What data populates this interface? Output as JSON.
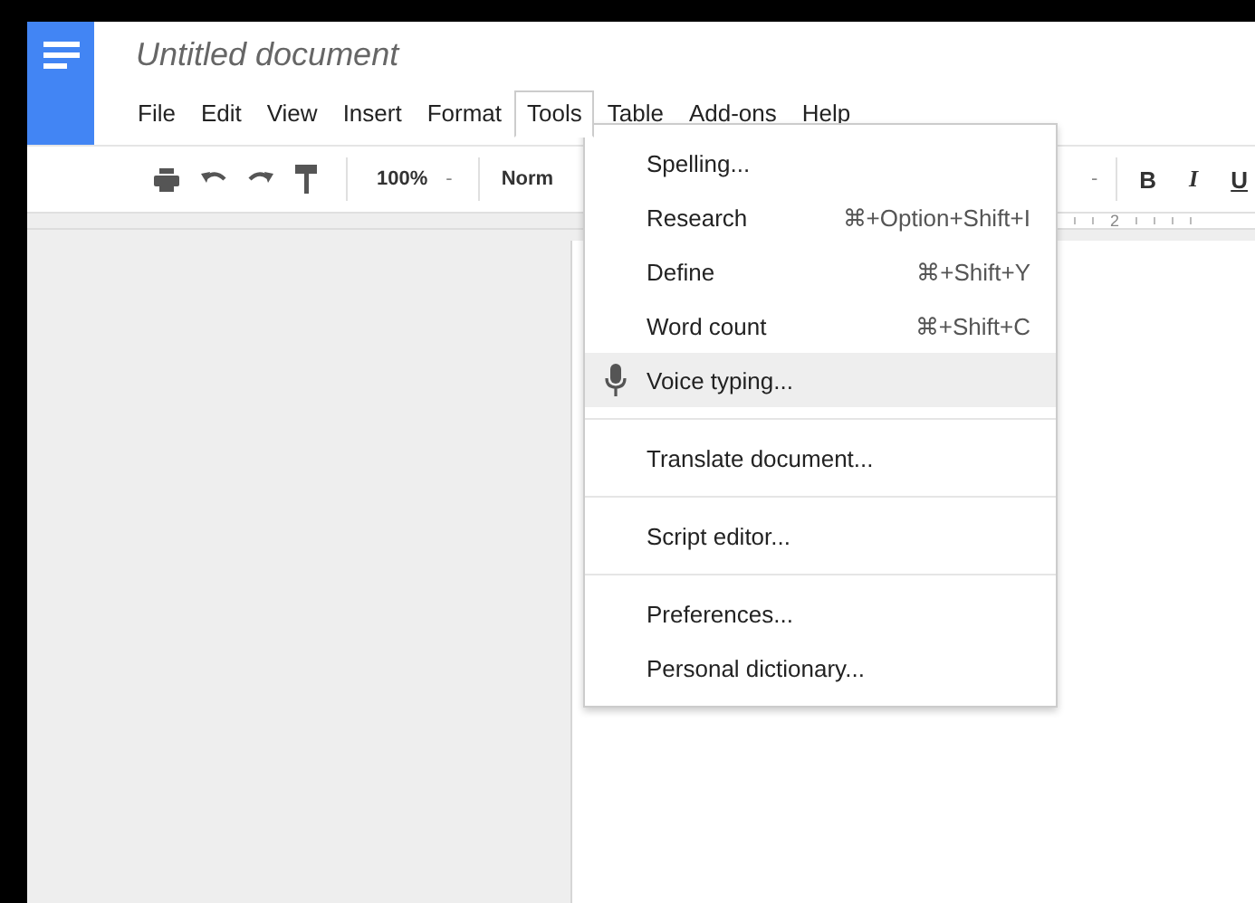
{
  "document": {
    "title": "Untitled document"
  },
  "menu_bar": [
    {
      "label": "File",
      "selected": false
    },
    {
      "label": "Edit",
      "selected": false
    },
    {
      "label": "View",
      "selected": false
    },
    {
      "label": "Insert",
      "selected": false
    },
    {
      "label": "Format",
      "selected": false
    },
    {
      "label": "Tools",
      "selected": true
    },
    {
      "label": "Table",
      "selected": false
    },
    {
      "label": "Add-ons",
      "selected": false
    },
    {
      "label": "Help",
      "selected": false
    }
  ],
  "toolbar": {
    "zoom": "100%",
    "zoom_caret": "-",
    "style": "Norm",
    "font_size_caret": "-",
    "bold": "B",
    "italic": "I",
    "underline": "U"
  },
  "ruler": {
    "label": "2"
  },
  "tools_menu": [
    {
      "kind": "item",
      "label": "Spelling...",
      "highlighted": false
    },
    {
      "kind": "item",
      "label": "Research",
      "shortcut": "⌘+Option+Shift+I",
      "highlighted": false
    },
    {
      "kind": "item",
      "label": "Define",
      "shortcut": "⌘+Shift+Y",
      "highlighted": false
    },
    {
      "kind": "item",
      "label": "Word count",
      "shortcut": "⌘+Shift+C",
      "highlighted": false
    },
    {
      "kind": "mic_item",
      "label": "Voice typing...",
      "highlighted": true
    },
    {
      "kind": "separator"
    },
    {
      "kind": "item",
      "label": "Translate document...",
      "highlighted": false
    },
    {
      "kind": "separator"
    },
    {
      "kind": "item",
      "label": "Script editor...",
      "highlighted": false
    },
    {
      "kind": "separator"
    },
    {
      "kind": "item",
      "label": "Preferences...",
      "highlighted": false
    },
    {
      "kind": "item",
      "label": "Personal dictionary...",
      "highlighted": false
    }
  ]
}
